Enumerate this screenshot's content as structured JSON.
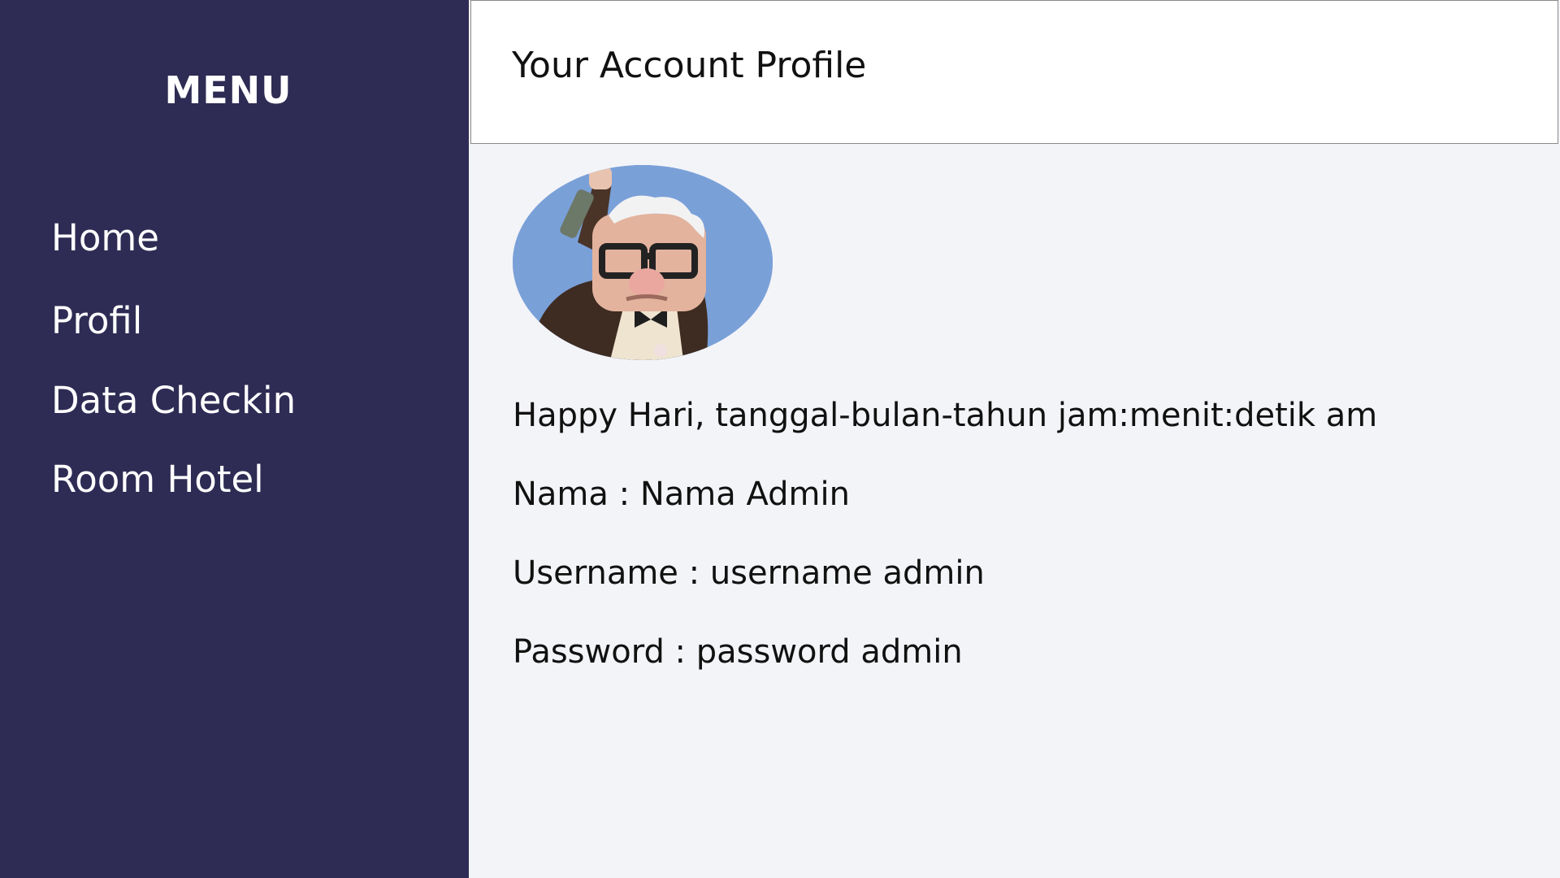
{
  "sidebar": {
    "title": "MENU",
    "items": [
      {
        "label": "Home"
      },
      {
        "label": "Profil"
      },
      {
        "label": "Data Checkin"
      },
      {
        "label": "Room Hotel"
      }
    ]
  },
  "header": {
    "title": "Your Account Profile"
  },
  "profile": {
    "avatar_icon": "user-avatar-icon",
    "greeting": "Happy Hari, tanggal-bulan-tahun jam:menit:detik am",
    "nama": "Nama : Nama Admin",
    "username": "Username : username admin",
    "password": "Password : password admin"
  },
  "colors": {
    "sidebar_bg": "#2e2c54",
    "content_bg": "#f3f4f8",
    "avatar_bg": "#7aa0d8"
  }
}
